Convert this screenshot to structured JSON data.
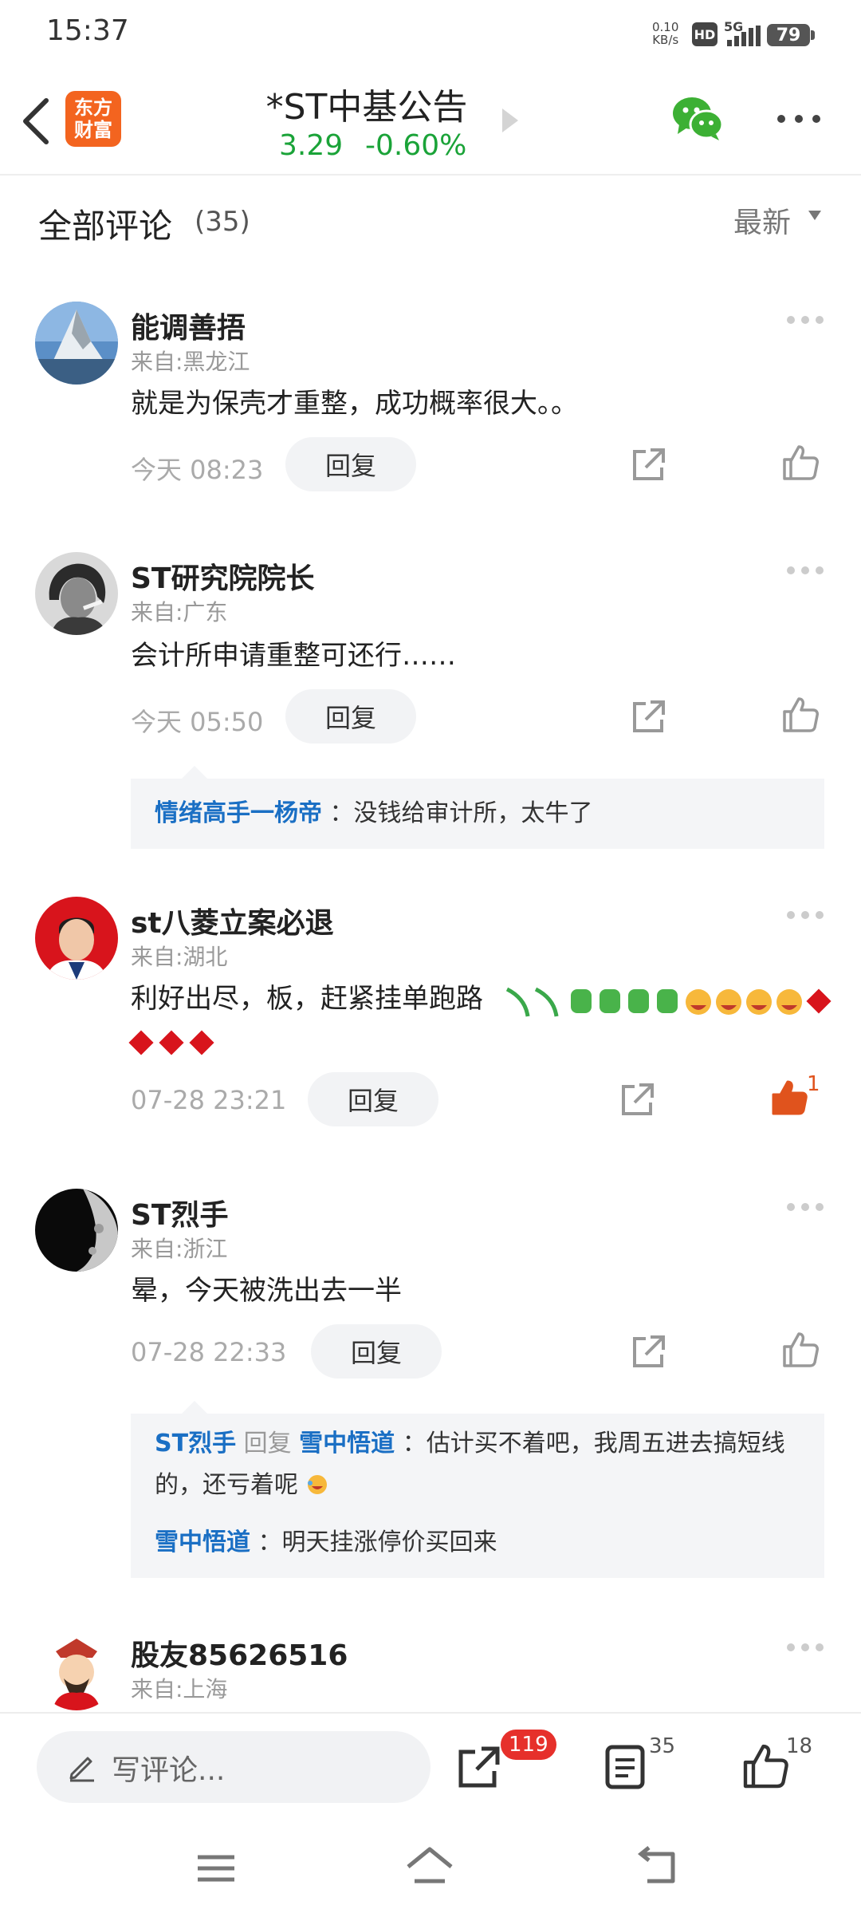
{
  "status_bar": {
    "time": "15:37",
    "net_speed_value": "0.10",
    "net_speed_unit": "KB/s",
    "hd": "HD",
    "network": "5G",
    "battery": "79"
  },
  "header": {
    "logo_line1": "东方",
    "logo_line2": "财富",
    "title": "*ST中基公告",
    "price": "3.29",
    "change": "-0.60%",
    "price_color": "#1aa338"
  },
  "comments_header": {
    "title": "全部评论",
    "count": "(35)",
    "sort": "最新"
  },
  "comments": [
    {
      "user": "能调善捂",
      "location": "来自:黑龙江",
      "text": "就是为保壳才重整，成功概率很大。。",
      "time": "今天 08:23",
      "reply_label": "回复"
    },
    {
      "user": "ST研究院院长",
      "location": "来自:广东",
      "text": "会计所申请重整可还行……",
      "time": "今天 05:50",
      "reply_label": "回复",
      "replies": [
        {
          "name": "情绪高手一杨帝",
          "text": "：没钱给审计所，太牛了"
        }
      ]
    },
    {
      "user": "st八菱立案必退",
      "location": "来自:湖北",
      "text": "利好出尽，板，赶紧挂单跑路",
      "time": "07-28 23:21",
      "reply_label": "回复",
      "likes": "1"
    },
    {
      "user": "ST烈手",
      "location": "来自:浙江",
      "text": "晕，今天被洗出去一半",
      "time": "07-28 22:33",
      "reply_label": "回复",
      "replies": [
        {
          "name": "ST烈手",
          "mid": "回复",
          "target": "雪中悟道",
          "text": "：估计买不着吧，我周五进去搞短线",
          "text2": "的，还亏着呢"
        },
        {
          "name": "雪中悟道",
          "text": "：明天挂涨停价买回来"
        }
      ]
    },
    {
      "user": "股友85626516",
      "location": "来自:上海"
    }
  ],
  "bottom_bar": {
    "input_placeholder": "写评论...",
    "share_badge": "119",
    "comments_count": "35",
    "likes_count": "18"
  },
  "icons": {
    "back": "back-arrow-icon",
    "wechat": "wechat-icon",
    "more": "more-icon",
    "share": "share-icon",
    "like": "thumbs-up-icon",
    "pencil": "pencil-icon",
    "list": "comment-list-icon"
  },
  "accent_colors": {
    "link": "#1a6fc4",
    "liked": "#e0531d",
    "badge": "#e6302b"
  }
}
